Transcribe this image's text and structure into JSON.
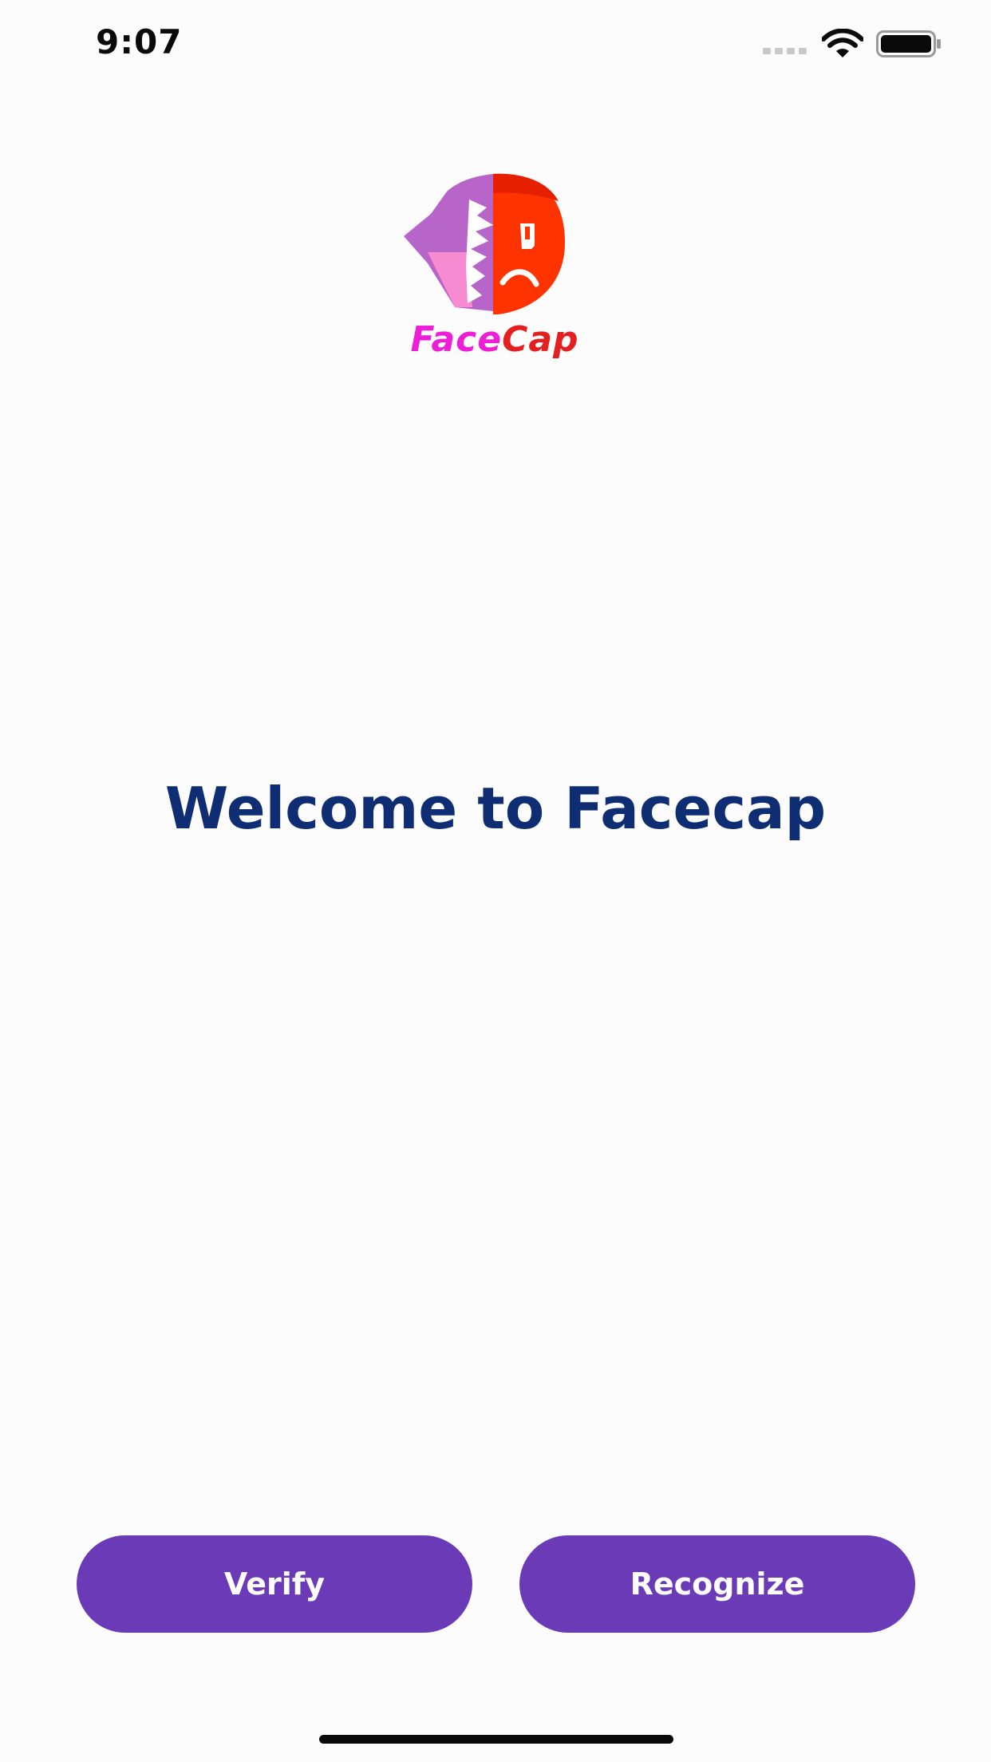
{
  "status_bar": {
    "time": "9:07",
    "signal_icon": "cellular-signal-icon",
    "wifi_icon": "wifi-icon",
    "battery_icon": "battery-icon"
  },
  "logo": {
    "text_face": "Face",
    "text_cap": "Cap",
    "colors": {
      "face": "#ec1fd6",
      "cap": "#e3201f",
      "purple": "#b865c9",
      "pink": "#f78bd1",
      "red": "#ff3300"
    }
  },
  "main": {
    "title": "Welcome to Facecap"
  },
  "actions": {
    "verify_label": "Verify",
    "recognize_label": "Recognize",
    "button_color": "#6a3ab7"
  }
}
